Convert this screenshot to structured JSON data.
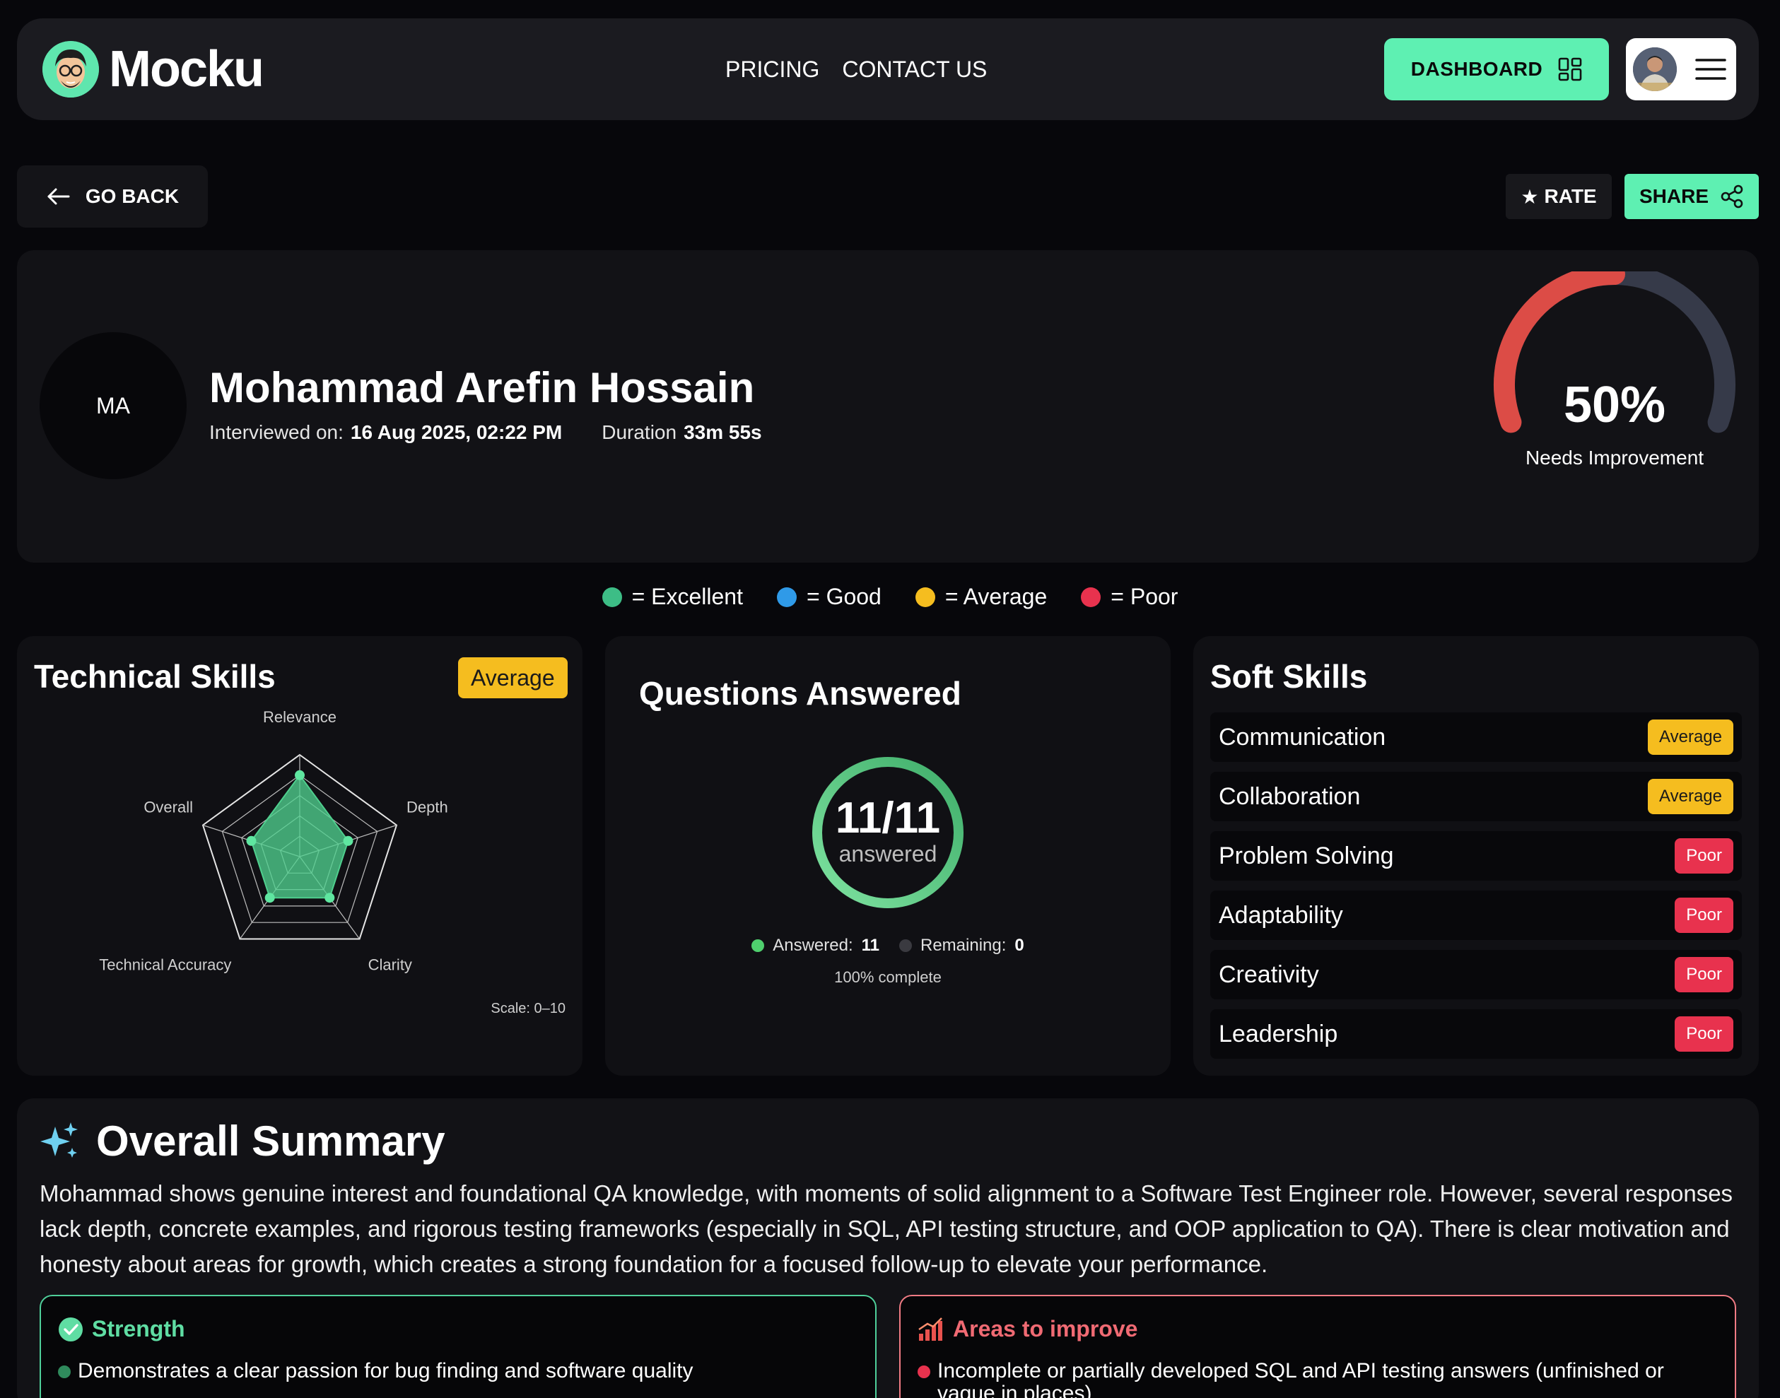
{
  "navbar": {
    "brand": "Mocku",
    "links": [
      "PRICING",
      "CONTACT US"
    ],
    "dashboard_label": "DASHBOARD"
  },
  "actions": {
    "go_back": "GO BACK",
    "rate": "RATE",
    "share": "SHARE"
  },
  "profile": {
    "initials": "MA",
    "name": "Mohammad Arefin Hossain",
    "interviewed_label": "Interviewed on:",
    "interviewed_value": "16 Aug 2025, 02:22 PM",
    "duration_label": "Duration",
    "duration_value": "33m 55s"
  },
  "score": {
    "value_text": "50%",
    "fraction": 0.5,
    "status": "Needs Improvement",
    "color_filled": "#dc4c46",
    "color_track": "#363a49"
  },
  "legend": [
    {
      "label": "= Excellent",
      "color": "#3dbd86"
    },
    {
      "label": "= Good",
      "color": "#2f9ae8"
    },
    {
      "label": "= Average",
      "color": "#f5bd1f"
    },
    {
      "label": "= Poor",
      "color": "#e8324e"
    }
  ],
  "technical": {
    "title": "Technical Skills",
    "badge": "Average",
    "scale_note": "Scale: 0–10",
    "axes": [
      "Relevance",
      "Depth",
      "Clarity",
      "Technical Accuracy",
      "Overall"
    ],
    "values": [
      8,
      5,
      5,
      5,
      5
    ],
    "max": 10,
    "fill_color": "#4fcf8e"
  },
  "questions": {
    "title": "Questions Answered",
    "value_text": "11/11",
    "sub": "answered",
    "answered_label": "Answered:",
    "answered_value": "11",
    "remaining_label": "Remaining:",
    "remaining_value": "0",
    "complete": "100% complete",
    "fraction": 1.0
  },
  "soft": {
    "title": "Soft Skills",
    "items": [
      {
        "label": "Communication",
        "rating": "Average"
      },
      {
        "label": "Collaboration",
        "rating": "Average"
      },
      {
        "label": "Problem Solving",
        "rating": "Poor"
      },
      {
        "label": "Adaptability",
        "rating": "Poor"
      },
      {
        "label": "Creativity",
        "rating": "Poor"
      },
      {
        "label": "Leadership",
        "rating": "Poor"
      }
    ]
  },
  "summary": {
    "title": "Overall Summary",
    "text": "Mohammad shows genuine interest and foundational QA knowledge, with moments of solid alignment to a Software Test Engineer role. However, several responses lack depth, concrete examples, and rigorous testing frameworks (especially in SQL, API testing structure, and OOP application to QA). There is clear motivation and honesty about areas for growth, which creates a strong foundation for a focused follow-up to elevate your performance.",
    "strength_title": "Strength",
    "strength_item": "Demonstrates a clear passion for bug finding and software quality",
    "improve_title": "Areas to improve",
    "improve_item": "Incomplete or partially developed SQL and API testing answers (unfinished or vague in places)"
  }
}
